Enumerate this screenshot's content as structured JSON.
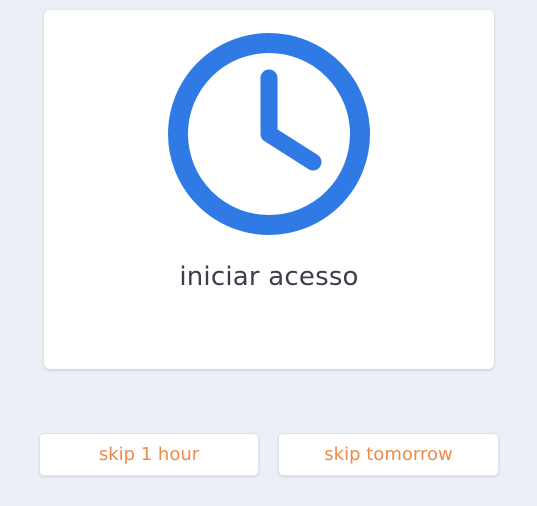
{
  "card": {
    "label": "iniciar acesso",
    "icon": "clock-icon"
  },
  "actions": {
    "skip_hour_label": "skip 1 hour",
    "skip_tomorrow_label": "skip tomorrow"
  },
  "colors": {
    "background": "#ecf0f6",
    "card": "#ffffff",
    "icon_accent": "#2f7ae5",
    "text": "#3b3f4a",
    "button_text": "#ef8a48"
  }
}
